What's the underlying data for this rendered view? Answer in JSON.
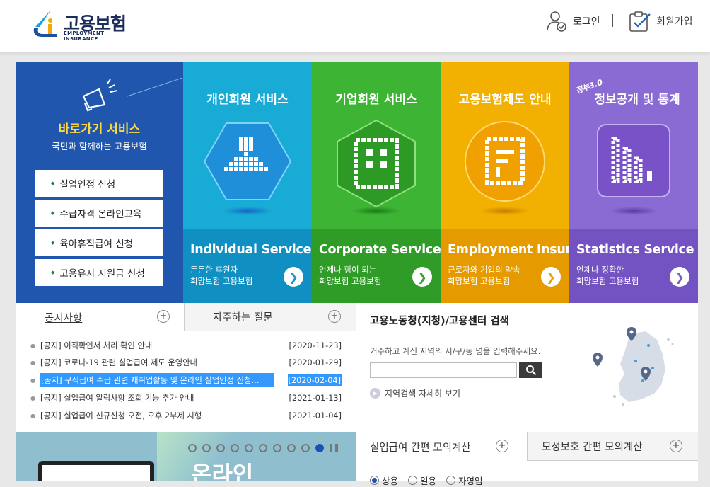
{
  "header": {
    "logo_ko": "고용보험",
    "logo_en": "EMPLOYMENT INSURANCE",
    "login_label": "로그인",
    "signup_label": "회원가입"
  },
  "quick": {
    "title": "바로가기 서비스",
    "subtitle": "국민과 함께하는 고용보험",
    "items": [
      {
        "label": "실업인정 신청"
      },
      {
        "label": "수급자격 온라인교육"
      },
      {
        "label": "육아휴직급여 신청"
      },
      {
        "label": "고용유지 지원금 신청"
      }
    ]
  },
  "services": [
    {
      "title": "개인회원 서비스",
      "title_en": "Individual Service",
      "desc1": "든든한 후원자",
      "desc2": "희망보험 고용보험",
      "color": "#17abd6",
      "bottom": "#0f8fc2",
      "arrow_color": "#1398cc"
    },
    {
      "title": "기업회원 서비스",
      "title_en": "Corporate Service",
      "desc1": "언제나 힘이 되는",
      "desc2": "희망보험 고용보험",
      "color": "#3db433",
      "bottom": "#2e9c27",
      "arrow_color": "#33a82b"
    },
    {
      "title": "고용보험제도 안내",
      "title_en": "Employment Insurance",
      "desc1": "근로자와 기업의 약속",
      "desc2": "희망보험 고용보험",
      "color": "#f2b000",
      "bottom": "#e59a00",
      "arrow_color": "#e9a300"
    },
    {
      "title": "정보공개 및 통계",
      "title_badge": "정부3.0",
      "title_en": "Statistics Service",
      "desc1": "언제나 정확한",
      "desc2": "희망보험 고용보험",
      "color": "#8a6bd4",
      "bottom": "#7352c2",
      "arrow_color": "#7d5ccc"
    }
  ],
  "notice": {
    "tab1": "공지사항",
    "tab2": "자주하는 질문",
    "plus": "+",
    "rows": [
      {
        "text": "[공지] 이직확인서 처리 확인 안내",
        "date": "[2020-11-23]"
      },
      {
        "text": "[공지] 코로나-19 관련 실업급여 제도 운영안내",
        "date": "[2020-01-29]"
      },
      {
        "text": "[공지] 구직급여 수급 관련 재취업활동 및 온라인 실업인정 신청…",
        "date": "[2020-02-04]",
        "selected": true
      },
      {
        "text": "[공지] 실업급여 알림사항 조회 기능 추가 안내",
        "date": "[2021-01-13]"
      },
      {
        "text": "[공지] 실업급여 신규신청 오전, 오후 2부제 시행",
        "date": "[2021-01-04]"
      }
    ]
  },
  "centers": {
    "title": "고용노동청(지청)/고용센터 검색",
    "desc": "거주하고 계신 지역의 시/구/동 명을 입력해주세요.",
    "input_value": "",
    "detail": "지역검색 자세히 보기"
  },
  "banner": {
    "text": "온라인",
    "dots": 10,
    "active_dot": 10
  },
  "calc": {
    "tab1": "실업급여 간편 모의계산",
    "tab2": "모성보호 간편 모의계산",
    "radios": [
      {
        "label": "상용",
        "checked": true
      },
      {
        "label": "일용",
        "checked": false
      },
      {
        "label": "자영업",
        "checked": false
      }
    ]
  }
}
